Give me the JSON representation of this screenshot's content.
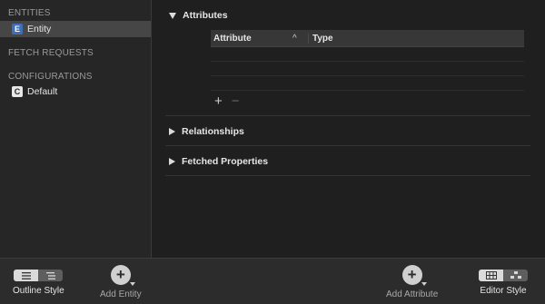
{
  "sidebar": {
    "entities_header": "ENTITIES",
    "entity_item": {
      "badge": "E",
      "label": "Entity"
    },
    "fetch_requests_header": "FETCH REQUESTS",
    "configurations_header": "CONFIGURATIONS",
    "config_item": {
      "badge": "C",
      "label": "Default"
    }
  },
  "main": {
    "attributes": {
      "title": "Attributes",
      "columns": {
        "attribute": "Attribute",
        "type": "Type",
        "sort_icon": "^"
      },
      "add": "+",
      "remove": "−"
    },
    "relationships": {
      "title": "Relationships"
    },
    "fetched_properties": {
      "title": "Fetched Properties"
    }
  },
  "toolbar": {
    "outline_style": "Outline Style",
    "add_entity": "Add Entity",
    "add_entity_icon": "+",
    "add_attribute": "Add Attribute",
    "add_attribute_icon": "+",
    "editor_style": "Editor Style"
  }
}
